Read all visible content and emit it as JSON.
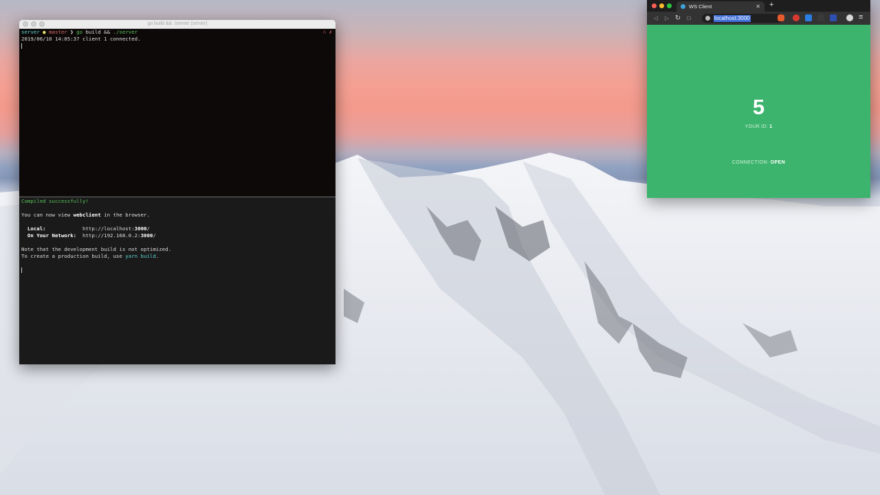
{
  "terminal": {
    "title": "go build && ./server (server)",
    "top_pane": {
      "prompt_dir": "server",
      "prompt_bullet": "●",
      "prompt_branch": "master",
      "prompt_arrow": "❯",
      "command_go": "go",
      "command_rest": " build && ",
      "command_exec": "./server",
      "prompt_right": "⑃ ✗",
      "log_line": "2019/06/10 14:05:37 client 1 connected."
    },
    "bottom_pane": {
      "compiled": "Compiled successfully!",
      "view_prefix": "You can now view ",
      "view_app": "webclient",
      "view_suffix": " in the browser.",
      "local_label": "Local:",
      "local_url_prefix": "http://localhost:",
      "local_port": "3000",
      "local_url_suffix": "/",
      "network_label": "On Your Network:",
      "network_url_prefix": "http://192.168.0.2:",
      "network_port": "3000",
      "network_url_suffix": "/",
      "note1": "Note that the development build is not optimized.",
      "note2_prefix": "To create a production build, use ",
      "note2_cmd": "yarn build",
      "note2_suffix": "."
    }
  },
  "browser": {
    "tab_title": "WS Client",
    "tab_close": "✕",
    "new_tab": "+",
    "back_icon": "◁",
    "forward_icon": "▷",
    "reload_icon": "↻",
    "bookmark_icon": "□",
    "url": "localhost:3000",
    "menu_icon": "≡",
    "counter": "5",
    "your_id_label": "YOUR ID: ",
    "your_id_value": "1",
    "connection_label": "CONNECTION: ",
    "connection_value": "OPEN"
  },
  "colors": {
    "browser_bg": "#3db46d",
    "terminal_bg": "#151313"
  }
}
